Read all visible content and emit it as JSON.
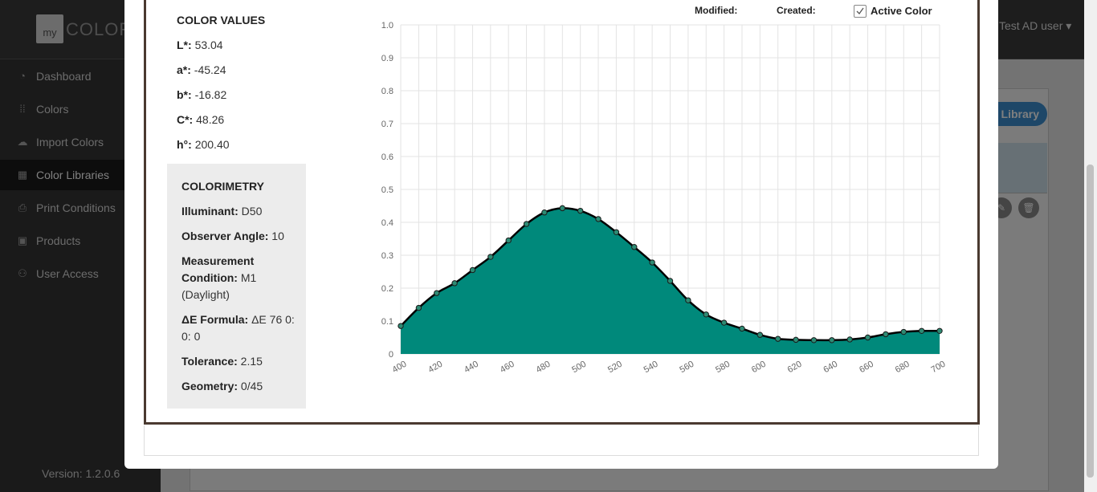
{
  "sidebar": {
    "logo_prefix": "my",
    "logo_text": "COLORS",
    "items": [
      {
        "label": "Dashboard",
        "icon": "dashboard-icon",
        "glyph": "◔"
      },
      {
        "label": "Colors",
        "icon": "grid-dots-icon",
        "glyph": "⁞⁞"
      },
      {
        "label": "Import Colors",
        "icon": "cloud-download-icon",
        "glyph": "☁"
      },
      {
        "label": "Color Libraries",
        "icon": "library-icon",
        "glyph": "▦"
      },
      {
        "label": "Print Conditions",
        "icon": "printer-icon",
        "glyph": "⎙"
      },
      {
        "label": "Products",
        "icon": "product-icon",
        "glyph": "▣"
      },
      {
        "label": "User Access",
        "icon": "users-icon",
        "glyph": "⚇"
      }
    ],
    "version": "Version: 1.2.0.6"
  },
  "topbar": {
    "user_label": "Test AD user ▾"
  },
  "background": {
    "library_button_label": "Library"
  },
  "modal": {
    "header": {
      "modified_label": "Modified:",
      "created_label": "Created:",
      "active_color_label": "Active Color",
      "active_color_checked": true
    },
    "color_values": {
      "title": "COLOR VALUES",
      "fields": [
        {
          "label": "L*:",
          "value": "53.04"
        },
        {
          "label": "a*:",
          "value": "-45.24"
        },
        {
          "label": "b*:",
          "value": "-16.82"
        },
        {
          "label": "C*:",
          "value": "48.26"
        },
        {
          "label": "h°:",
          "value": "200.40"
        }
      ]
    },
    "colorimetry": {
      "title": "COLORIMETRY",
      "illuminant_label": "Illuminant:",
      "illuminant_value": "D50",
      "observer_label": "Observer Angle:",
      "observer_value": "10",
      "measurement_label_1": "Measurement",
      "measurement_label_2": "Condition:",
      "measurement_value_1": "M1",
      "measurement_value_2": "(Daylight)",
      "de_label": "ΔE Formula:",
      "de_value_1": "ΔE 76  0:",
      "de_value_2": "0: 0",
      "tolerance_label": "Tolerance:",
      "tolerance_value": "2.15",
      "geometry_label": "Geometry:",
      "geometry_value": "0/45"
    }
  },
  "chart_data": {
    "type": "area",
    "x": [
      400,
      410,
      420,
      430,
      440,
      450,
      460,
      470,
      480,
      490,
      500,
      510,
      520,
      530,
      540,
      550,
      560,
      570,
      580,
      590,
      600,
      610,
      620,
      630,
      640,
      650,
      660,
      670,
      680,
      690,
      700
    ],
    "series": [
      {
        "values": [
          0.085,
          0.14,
          0.185,
          0.215,
          0.255,
          0.295,
          0.345,
          0.395,
          0.43,
          0.443,
          0.435,
          0.41,
          0.37,
          0.325,
          0.278,
          0.222,
          0.163,
          0.12,
          0.095,
          0.077,
          0.058,
          0.046,
          0.043,
          0.042,
          0.042,
          0.044,
          0.05,
          0.06,
          0.067,
          0.07,
          0.07
        ]
      }
    ],
    "xticks": [
      "400",
      "420",
      "440",
      "460",
      "480",
      "500",
      "520",
      "540",
      "560",
      "580",
      "600",
      "620",
      "640",
      "660",
      "680",
      "700"
    ],
    "yticks": [
      "0",
      "0.1",
      "0.2",
      "0.3",
      "0.4",
      "0.5",
      "0.6",
      "0.7",
      "0.8",
      "0.9",
      "1.0"
    ],
    "xlim": [
      400,
      700
    ],
    "ylim": [
      0,
      1.0
    ],
    "grid": true,
    "fill_color": "#00897b",
    "line_color": "#000000",
    "title": "",
    "xlabel": "",
    "ylabel": ""
  }
}
